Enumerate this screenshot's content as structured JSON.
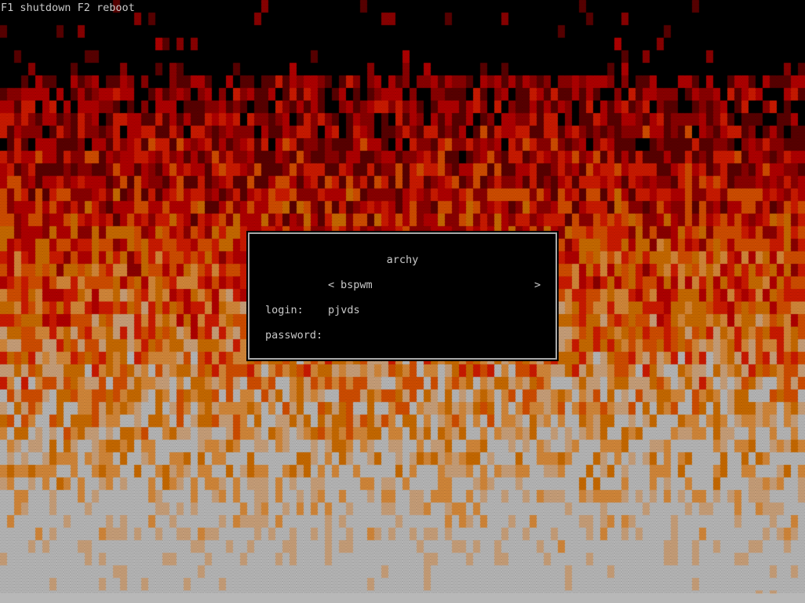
{
  "hints": {
    "shutdown_key": "F1",
    "shutdown_label": "shutdown",
    "reboot_key": "F2",
    "reboot_label": "reboot"
  },
  "login_box": {
    "hostname": "archy",
    "session": {
      "prev_icon": "<",
      "name": "bspwm",
      "next_icon": ">"
    },
    "login_label": "login:",
    "login_value": "pjvds",
    "password_label": "password:",
    "password_value": ""
  },
  "colors": {
    "background": "#000000",
    "border": "#a8a8a8",
    "text": "#c8c8c8",
    "fire_palette": [
      "#000000",
      "#5a0000",
      "#8b0000",
      "#b00000",
      "#cc1a00",
      "#d14d00",
      "#c86a00",
      "#d4883a",
      "#c9a07a",
      "#b8b8b8"
    ]
  }
}
